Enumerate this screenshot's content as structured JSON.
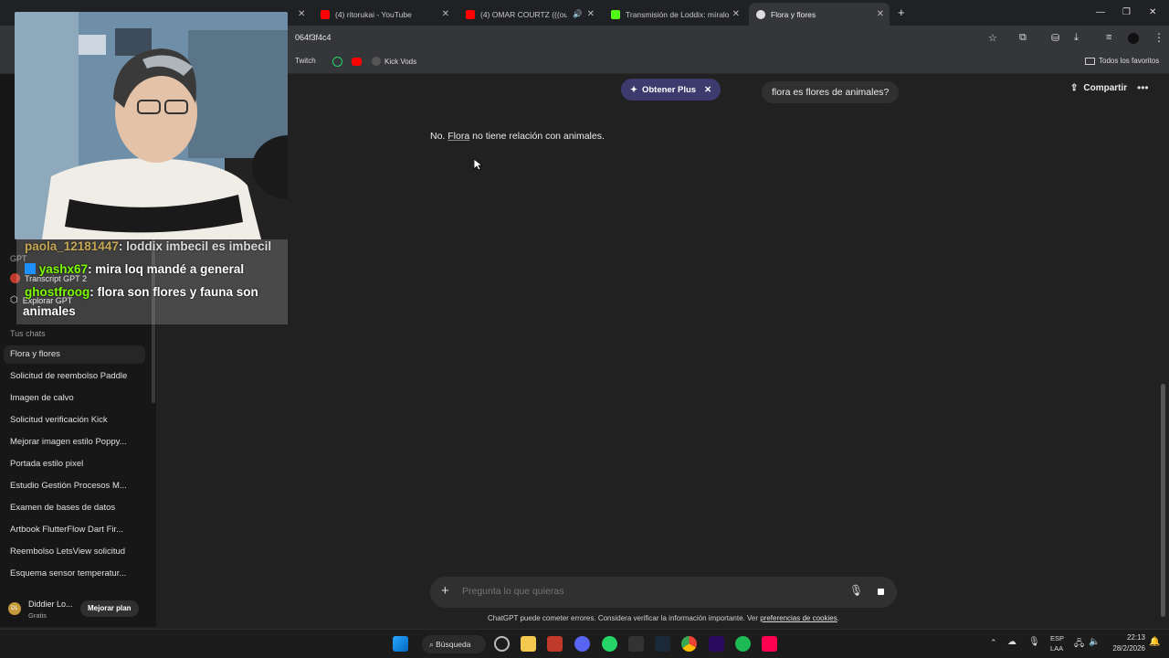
{
  "tabs": [
    {
      "title": "(4) ritorukai - YouTube",
      "color": "#ff0000"
    },
    {
      "title": "(4) OMAR COURTZ (((ousi)))",
      "color": "#ff0000"
    },
    {
      "title": "Transmisión de Loddix: míralo e",
      "color": "#53fc18"
    },
    {
      "title": "Flora y flores",
      "color": "#dddddd"
    }
  ],
  "address": {
    "url": "064f3f4c4"
  },
  "bookmarks": [
    "Twitch",
    "Kick Vods",
    "Todos los favoritos"
  ],
  "sidebar": {
    "section_gpt": "GPT",
    "gpts": [
      "Transcript GPT 2",
      "Explorar GPT"
    ],
    "section_chats": "Tus chats",
    "chats": [
      "Flora y flores",
      "Solicitud de reembolso Paddle",
      "Imagen de calvo",
      "Solicitud verificación Kick",
      "Mejorar imagen estilo Poppy...",
      "Portada estilo pixel",
      "Estudio Gestión Procesos M...",
      "Examen de bases de datos",
      "Artbook FlutterFlow Dart Fir...",
      "Reembolso LetsView solicitud",
      "Esquema sensor temperatur..."
    ],
    "user": {
      "initials": "DL",
      "name": "Diddier Lo...",
      "plan": "Gratis",
      "upgrade": "Mejorar plan"
    }
  },
  "stream_chat": [
    {
      "user": "paola_12181447",
      "message": ": loddix imbecil es imbecil"
    },
    {
      "user": "yashx67",
      "message": ": mira loq mandé a general"
    },
    {
      "user": "ghostfroog",
      "message": ": flora son flores y fauna son"
    },
    {
      "user": "",
      "message": "animales"
    }
  ],
  "main": {
    "plus_button": "Obtener Plus",
    "user_message": "flora es flores de animales?",
    "answer_prefix": "No. ",
    "answer_link": "Flora",
    "answer_rest": " no tiene relación con animales.",
    "share": "Compartir",
    "composer_placeholder": "Pregunta lo que quieras",
    "disclaimer": "ChatGPT puede cometer errores. Considera verificar la información importante. Ver ",
    "disclaimer_link": "preferencias de cookies",
    "disclaimer_end": "."
  },
  "taskbar": {
    "search": "Búsqueda",
    "lang1": "ESP",
    "lang2": "LAA",
    "time": "22:13",
    "date": "28/2/2026"
  }
}
